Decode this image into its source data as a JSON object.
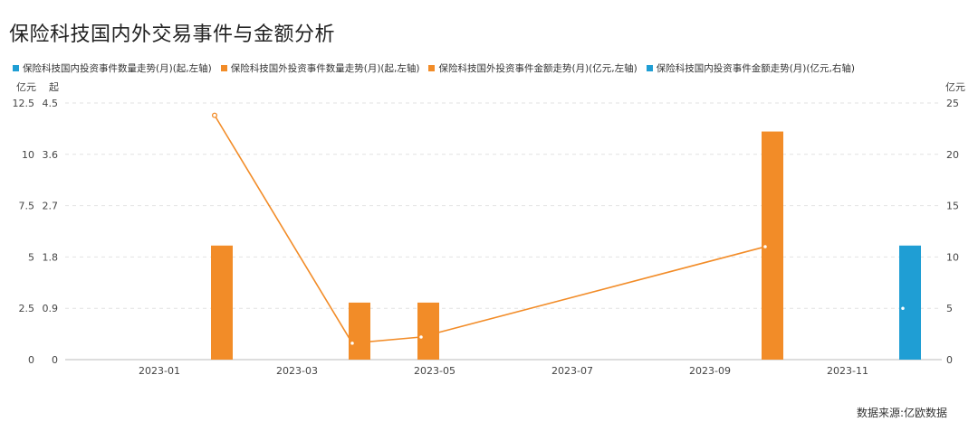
{
  "title": "保险科技国内外交易事件与金额分析",
  "source": "数据来源:亿欧数据",
  "legend": [
    {
      "label": "保险科技国内投资事件数量走势(月)(起,左轴)",
      "color": "#1f9ed4"
    },
    {
      "label": "保险科技国外投资事件数量走势(月)(起,左轴)",
      "color": "#f28c28"
    },
    {
      "label": "保险科技国外投资事件金额走势(月)(亿元,左轴)",
      "color": "#f28c28"
    },
    {
      "label": "保险科技国内投资事件金额走势(月)(亿元,右轴)",
      "color": "#1f9ed4"
    }
  ],
  "chart_data": {
    "type": "bar",
    "x_ticks": [
      "2023-01",
      "2023-03",
      "2023-05",
      "2023-07",
      "2023-09",
      "2023-11"
    ],
    "left_axis_1": {
      "unit": "亿元",
      "ticks": [
        "0",
        "2.5",
        "5",
        "7.5",
        "10",
        "12.5"
      ],
      "ylim": [
        0,
        12.5
      ]
    },
    "left_axis_2": {
      "unit": "起",
      "ticks": [
        "0",
        "0.9",
        "1.8",
        "2.7",
        "3.6",
        "4.5"
      ],
      "ylim": [
        0,
        4.5
      ]
    },
    "right_axis": {
      "unit": "亿元",
      "ticks": [
        "0",
        "5",
        "10",
        "15",
        "20",
        "25"
      ],
      "ylim": [
        0,
        25
      ]
    },
    "grid": "horizontal dashed",
    "series": [
      {
        "name": "保险科技国内投资事件数量走势(月)(起,左轴)",
        "kind": "bar",
        "axis": "count",
        "color": "#1f9ed4",
        "points": [
          {
            "x": "2023-12",
            "y": 2
          }
        ]
      },
      {
        "name": "保险科技国外投资事件数量走势(月)(起,左轴)",
        "kind": "bar",
        "axis": "count",
        "color": "#f28c28",
        "points": [
          {
            "x": "2023-02",
            "y": 2
          },
          {
            "x": "2023-04",
            "y": 1
          },
          {
            "x": "2023-05",
            "y": 1
          },
          {
            "x": "2023-10",
            "y": 4
          }
        ]
      },
      {
        "name": "保险科技国外投资事件金额走势(月)(亿元,左轴)",
        "kind": "line",
        "axis": "amount_left",
        "color": "#f28c28",
        "points": [
          {
            "x": "2023-02",
            "y": 11.9
          },
          {
            "x": "2023-04",
            "y": 0.8
          },
          {
            "x": "2023-05",
            "y": 1.1
          },
          {
            "x": "2023-10",
            "y": 5.5
          }
        ]
      },
      {
        "name": "保险科技国内投资事件金额走势(月)(亿元,右轴)",
        "kind": "line",
        "axis": "amount_right",
        "color": "#1f9ed4",
        "points": [
          {
            "x": "2023-12",
            "y": 5
          }
        ]
      }
    ]
  }
}
